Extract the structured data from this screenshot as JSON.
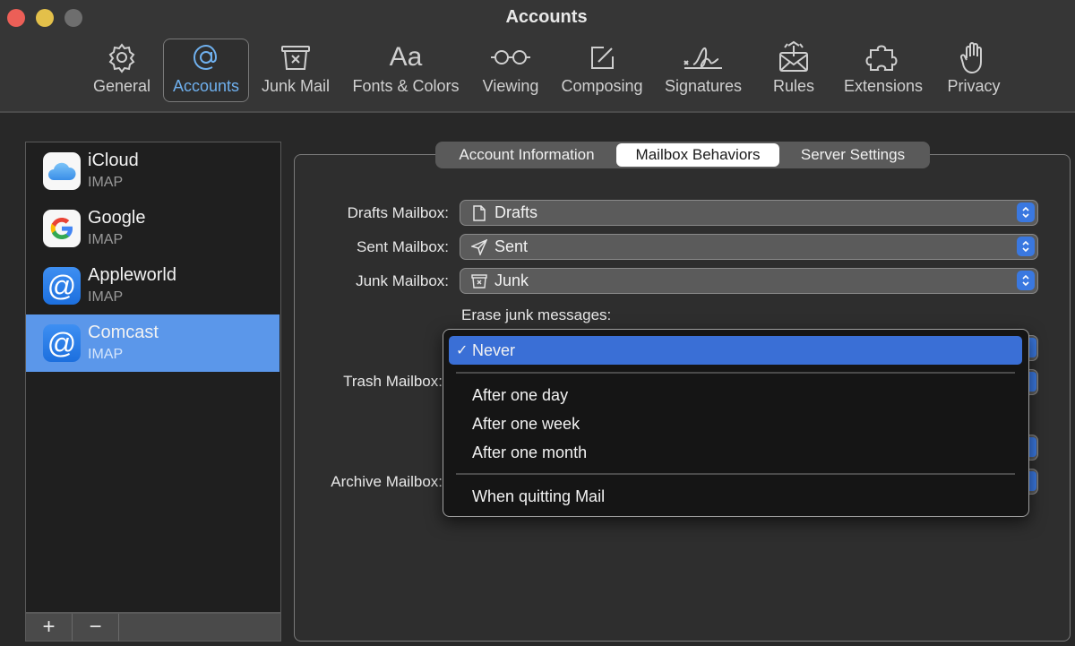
{
  "window": {
    "title": "Accounts",
    "controls": [
      "close",
      "minimize",
      "zoom"
    ]
  },
  "toolbar": {
    "items": [
      {
        "label": "General",
        "icon": "gear-icon",
        "active": false
      },
      {
        "label": "Accounts",
        "icon": "at-icon",
        "active": true
      },
      {
        "label": "Junk Mail",
        "icon": "junk-bin-icon",
        "active": false
      },
      {
        "label": "Fonts & Colors",
        "icon": "font-icon",
        "active": false
      },
      {
        "label": "Viewing",
        "icon": "glasses-icon",
        "active": false
      },
      {
        "label": "Composing",
        "icon": "compose-icon",
        "active": false
      },
      {
        "label": "Signatures",
        "icon": "signature-icon",
        "active": false
      },
      {
        "label": "Rules",
        "icon": "rules-envelope-icon",
        "active": false
      },
      {
        "label": "Extensions",
        "icon": "puzzle-icon",
        "active": false
      },
      {
        "label": "Privacy",
        "icon": "hand-icon",
        "active": false
      }
    ]
  },
  "accounts": {
    "items": [
      {
        "name": "iCloud",
        "type": "IMAP",
        "icon": "icloud-icon",
        "selected": false
      },
      {
        "name": "Google",
        "type": "IMAP",
        "icon": "google-icon",
        "selected": false
      },
      {
        "name": "Appleworld",
        "type": "IMAP",
        "icon": "at-icon",
        "selected": false
      },
      {
        "name": "Comcast",
        "type": "IMAP",
        "icon": "at-icon",
        "selected": true
      }
    ],
    "add_label": "+",
    "remove_label": "−"
  },
  "tabs": {
    "items": [
      {
        "label": "Account Information",
        "active": false
      },
      {
        "label": "Mailbox Behaviors",
        "active": true
      },
      {
        "label": "Server Settings",
        "active": false
      }
    ]
  },
  "mailbox": {
    "drafts": {
      "label": "Drafts Mailbox:",
      "value": "Drafts",
      "icon": "document-icon"
    },
    "sent": {
      "label": "Sent Mailbox:",
      "value": "Sent",
      "icon": "paper-plane-icon"
    },
    "junk": {
      "label": "Junk Mailbox:",
      "value": "Junk",
      "icon": "junk-bin-icon"
    },
    "erase_junk_label": "Erase junk messages:",
    "trash_label": "Trash Mailbox:",
    "archive_label": "Archive Mailbox:"
  },
  "erase_menu": {
    "selected": "Never",
    "check": "✓",
    "options": [
      "Never",
      "After one day",
      "After one week",
      "After one month",
      "When quitting Mail"
    ]
  },
  "colors": {
    "accent": "#3a6fd6",
    "selection": "#5b97ea",
    "toolbar_active": "#6fb0ee"
  }
}
